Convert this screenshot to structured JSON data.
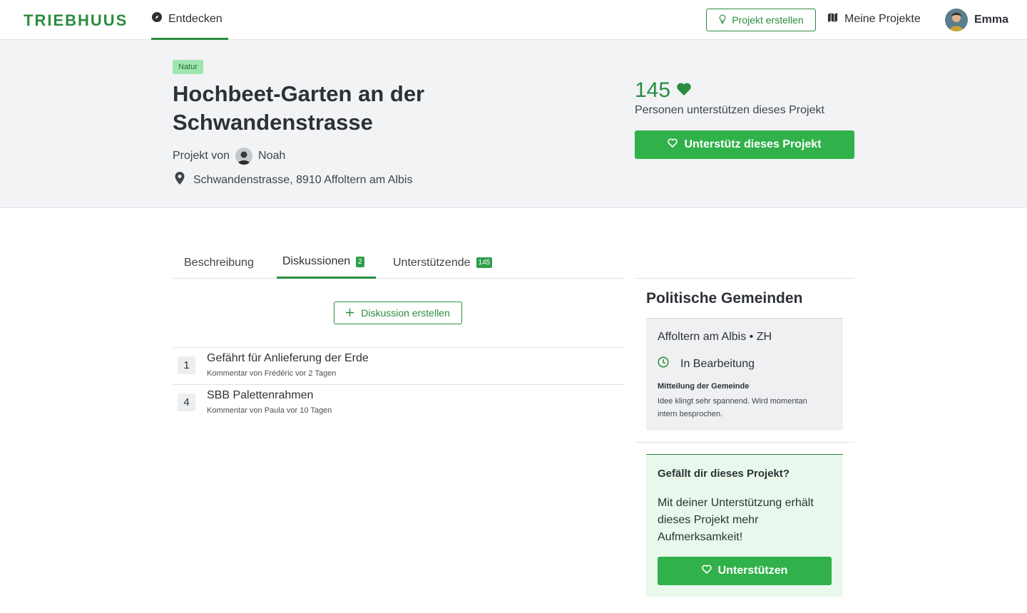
{
  "brand": {
    "logo": "TRIEBHUUS",
    "accent": "#2a8c3f",
    "button_green": "#30b14a"
  },
  "nav": {
    "discover": {
      "label": "Entdecken",
      "icon": "compass-icon"
    },
    "create_project": {
      "label": "Projekt erstellen",
      "icon": "lightbulb-icon"
    },
    "my_projects": {
      "label": "Meine Projekte",
      "icon": "map-icon"
    },
    "user": {
      "name": "Emma"
    }
  },
  "project": {
    "tag": "Natur",
    "title": "Hochbeet-Garten an der Schwandenstrasse",
    "by_prefix": "Projekt von",
    "author": "Noah",
    "location": "Schwandenstrasse, 8910 Affoltern am Albis",
    "supporter_count": "145",
    "supporter_caption": "Personen unterstützen dieses Projekt",
    "support_button": "Unterstütz dieses Projekt"
  },
  "tabs": [
    {
      "label": "Beschreibung",
      "badge": null,
      "active": false
    },
    {
      "label": "Diskussionen",
      "badge": "2",
      "active": true
    },
    {
      "label": "Unterstützende",
      "badge": "145",
      "active": false
    }
  ],
  "discussions": {
    "create_button": "Diskussion erstellen",
    "items": [
      {
        "count": "1",
        "title": "Gefährt für Anlieferung der Erde",
        "meta": "Kommentar von Frédéric vor 2 Tagen"
      },
      {
        "count": "4",
        "title": "SBB Palettenrahmen",
        "meta": "Kommentar von Paula vor 10 Tagen"
      }
    ]
  },
  "sidebar": {
    "heading": "Politische Gemeinden",
    "gemeinde": {
      "name": "Affoltern am Albis • ZH",
      "status": "In Bearbeitung",
      "message_label": "Mitteilung der Gemeinde",
      "message": "Idee klingt sehr spannend. Wird momentan intern besprochen."
    },
    "cta": {
      "title": "Gefällt dir dieses Projekt?",
      "text": "Mit deiner Unterstützung erhält dieses Projekt mehr Aufmerksamkeit!",
      "button": "Unterstützen"
    }
  }
}
